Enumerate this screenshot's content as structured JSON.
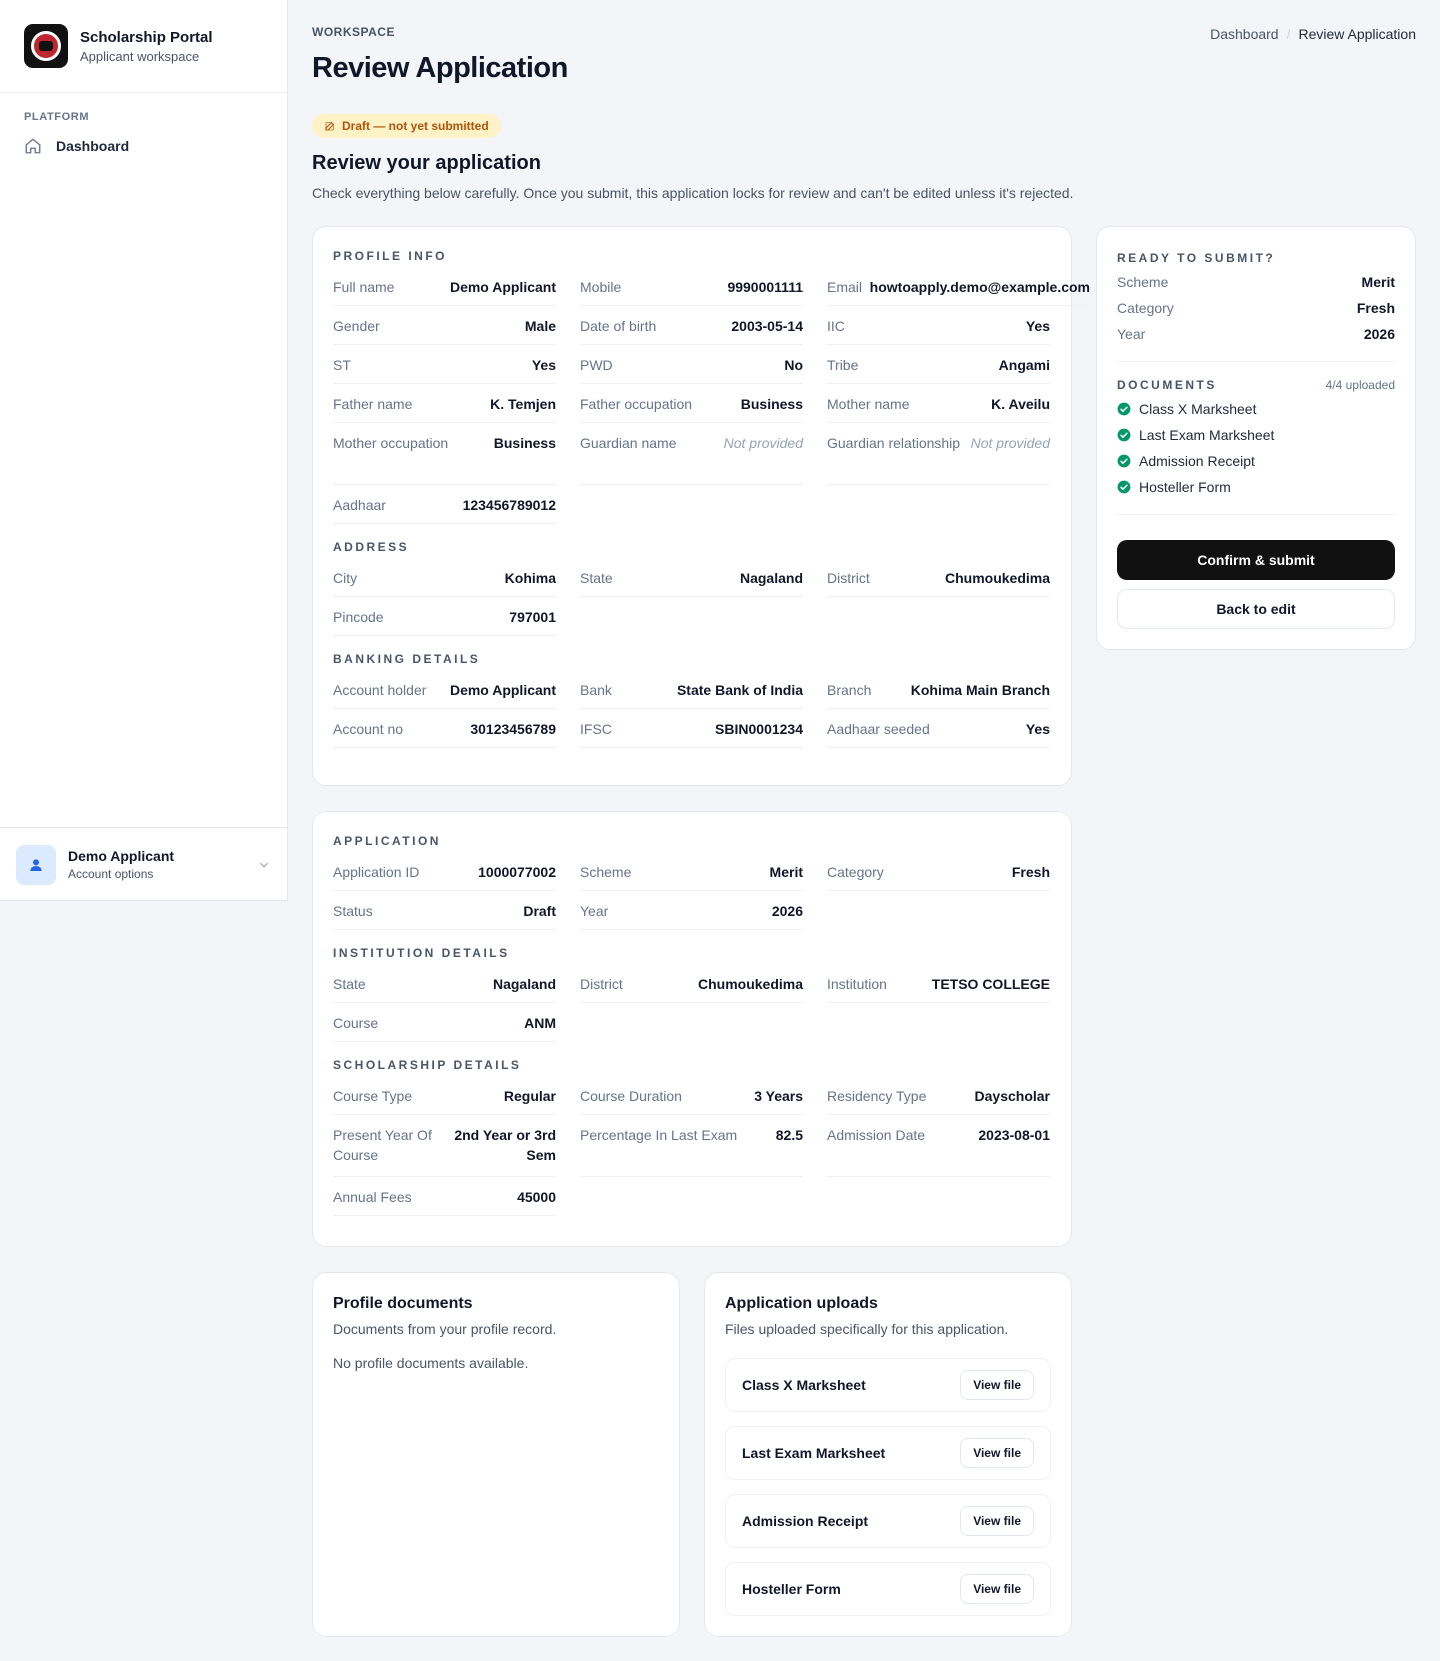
{
  "sidebar": {
    "brand_title": "Scholarship Portal",
    "brand_sub": "Applicant workspace",
    "section": "PLATFORM",
    "nav": [
      {
        "label": "Dashboard"
      }
    ],
    "user_name": "Demo Applicant",
    "user_sub": "Account options"
  },
  "header": {
    "eyebrow": "WORKSPACE",
    "title": "Review Application",
    "breadcrumb": [
      "Dashboard",
      "/",
      "Review Application"
    ]
  },
  "status_badge": "Draft — not yet submitted",
  "review": {
    "title": "Review your application",
    "desc": "Check everything below carefully. Once you submit, this application locks for review and can't be edited unless it's rejected."
  },
  "profile_card": {
    "profile_head": "PROFILE INFO",
    "profile": [
      {
        "label": "Full name",
        "value": "Demo Applicant"
      },
      {
        "label": "Mobile",
        "value": "9990001111"
      },
      {
        "label": "Email",
        "value": "howtoapply.demo@example.com"
      },
      {
        "label": "Gender",
        "value": "Male"
      },
      {
        "label": "Date of birth",
        "value": "2003-05-14"
      },
      {
        "label": "IIC",
        "value": "Yes"
      },
      {
        "label": "ST",
        "value": "Yes"
      },
      {
        "label": "PWD",
        "value": "No"
      },
      {
        "label": "Tribe",
        "value": "Angami"
      },
      {
        "label": "Father name",
        "value": "K. Temjen"
      },
      {
        "label": "Father occupation",
        "value": "Business"
      },
      {
        "label": "Mother name",
        "value": "K. Aveilu"
      },
      {
        "label": "Mother occupation",
        "value": "Business"
      },
      {
        "label": "Guardian name",
        "value": "Not provided"
      },
      {
        "label": "Guardian relationship",
        "value": "Not provided"
      },
      {
        "label": "Aadhaar",
        "value": "123456789012"
      }
    ],
    "address_head": "ADDRESS",
    "address": [
      {
        "label": "City",
        "value": "Kohima"
      },
      {
        "label": "State",
        "value": "Nagaland"
      },
      {
        "label": "District",
        "value": "Chumoukedima"
      },
      {
        "label": "Pincode",
        "value": "797001"
      }
    ],
    "banking_head": "BANKING DETAILS",
    "banking": [
      {
        "label": "Account holder",
        "value": "Demo Applicant"
      },
      {
        "label": "Bank",
        "value": "State Bank of India"
      },
      {
        "label": "Branch",
        "value": "Kohima Main Branch"
      },
      {
        "label": "Account no",
        "value": "30123456789"
      },
      {
        "label": "IFSC",
        "value": "SBIN0001234"
      },
      {
        "label": "Aadhaar seeded",
        "value": "Yes"
      }
    ]
  },
  "application_card": {
    "application_head": "APPLICATION",
    "application": [
      {
        "label": "Application ID",
        "value": "1000077002"
      },
      {
        "label": "Scheme",
        "value": "Merit"
      },
      {
        "label": "Category",
        "value": "Fresh"
      },
      {
        "label": "Status",
        "value": "Draft"
      },
      {
        "label": "Year",
        "value": "2026"
      }
    ],
    "institution_head": "INSTITUTION DETAILS",
    "institution": [
      {
        "label": "State",
        "value": "Nagaland"
      },
      {
        "label": "District",
        "value": "Chumoukedima"
      },
      {
        "label": "Institution",
        "value": "TETSO COLLEGE"
      },
      {
        "label": "Course",
        "value": "ANM"
      }
    ],
    "scholarship_head": "SCHOLARSHIP DETAILS",
    "scholarship": [
      {
        "label": "Course Type",
        "value": "Regular"
      },
      {
        "label": "Course Duration",
        "value": "3 Years"
      },
      {
        "label": "Residency Type",
        "value": "Dayscholar"
      },
      {
        "label": "Present Year Of Course",
        "value": "2nd Year or 3rd Sem"
      },
      {
        "label": "Percentage In Last Exam",
        "value": "82.5"
      },
      {
        "label": "Admission Date",
        "value": "2023-08-01"
      },
      {
        "label": "Annual Fees",
        "value": "45000"
      }
    ]
  },
  "summary": {
    "head": "READY TO SUBMIT?",
    "rows": [
      {
        "label": "Scheme",
        "value": "Merit"
      },
      {
        "label": "Category",
        "value": "Fresh"
      },
      {
        "label": "Year",
        "value": "2026"
      }
    ],
    "docs_head": "DOCUMENTS",
    "docs_count": "4/4 uploaded",
    "docs": [
      "Class X Marksheet",
      "Last Exam Marksheet",
      "Admission Receipt",
      "Hosteller Form"
    ],
    "submit_label": "Confirm & submit",
    "back_label": "Back to edit"
  },
  "profile_docs": {
    "title": "Profile documents",
    "desc": "Documents from your profile record.",
    "empty": "No profile documents available."
  },
  "uploads": {
    "title": "Application uploads",
    "desc": "Files uploaded specifically for this application.",
    "items": [
      {
        "name": "Class X Marksheet",
        "action": "View file"
      },
      {
        "name": "Last Exam Marksheet",
        "action": "View file"
      },
      {
        "name": "Admission Receipt",
        "action": "View file"
      },
      {
        "name": "Hosteller Form",
        "action": "View file"
      }
    ]
  },
  "colors": {
    "accent": "#111111",
    "badge_bg": "#fef3c7",
    "badge_text": "#b45309",
    "success": "#059669"
  }
}
